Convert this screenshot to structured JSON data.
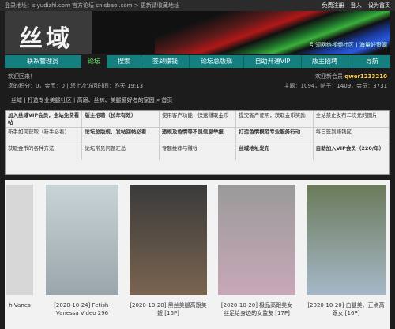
{
  "topbar": {
    "left_text": "登录地址：siyudizhi.com  官方论坛 cn.sbaol.com  > 更新请收藏地址",
    "links": [
      "免费注册",
      "登入",
      "设为首页"
    ]
  },
  "banner": {
    "logo": "丝域",
    "tagline": "引领网络视频社区丨海量好资源"
  },
  "nav": {
    "items": [
      "联系管理员",
      "论坛",
      "搜索",
      "签到赚钱",
      "论坛总版规",
      "自助开通VIP",
      "版主招聘",
      "导航"
    ],
    "active_index": 1
  },
  "info": {
    "welcome": "欢迎回来！",
    "stats_left": "您的积分：0，金币：0 | 您上次访问时间：昨天 19:13",
    "user_label": "欢迎新会员",
    "username": "qwer1233210",
    "stats_right": "主题：1094，帖子：1409，会员：3731"
  },
  "breadcrumb": "丝域 | 打造专业美腿社区 | 高跟、丝袜、美腿爱好者的家园 » 首页",
  "grid": [
    [
      {
        "text": "加入丝域VIP会员，全站免费看帖",
        "style": "blue"
      },
      {
        "text": "版主招聘（长年有效）",
        "style": "red"
      },
      {
        "text": "使用客户功能，快速赚取金币",
        "style": "grey"
      },
      {
        "text": "提交客户证明，获取金币奖励",
        "style": "grey"
      },
      {
        "text": "全站禁止发布二次元的图片",
        "style": "grey"
      }
    ],
    [
      {
        "text": "新手如何获取（新手必看）",
        "style": "grey"
      },
      {
        "text": "论坛总版规，发帖回帖必看",
        "style": "blue"
      },
      {
        "text": "违规及色情等不良信息举报",
        "style": "blue"
      },
      {
        "text": "打造色情模范专业服务行动",
        "style": "red"
      },
      {
        "text": "每日签到赚钱区",
        "style": "grey"
      }
    ],
    [
      {
        "text": "获取金币的各种方法",
        "style": "grey"
      },
      {
        "text": "论坛常见问题汇总",
        "style": "grey"
      },
      {
        "text": "专题推荐与赚钱",
        "style": "grey"
      },
      {
        "text": "丝域地址发布",
        "style": "red"
      },
      {
        "text": "自助加入VIP会员（220/年）",
        "style": "red"
      }
    ]
  ],
  "thumbs": [
    {
      "caption": "h-Vanes",
      "bg": "#d7d7d7"
    },
    {
      "caption": "[2020-10-24] Fetish-Vanessa Video 296",
      "bg": "#bdbdbd"
    },
    {
      "caption": "[2020-10-20] 黑丝美腿高跟美妞 [16P]",
      "bg": "#6c5b4d"
    },
    {
      "caption": "[2020-10-20] 极品高跟美女 丝足给身边的女监友 [17P]",
      "bg": "#8b8b8b"
    },
    {
      "caption": "[2020-10-20] 白腿美、正点高跟女 [16P]",
      "bg": "#7a8a6a"
    }
  ]
}
